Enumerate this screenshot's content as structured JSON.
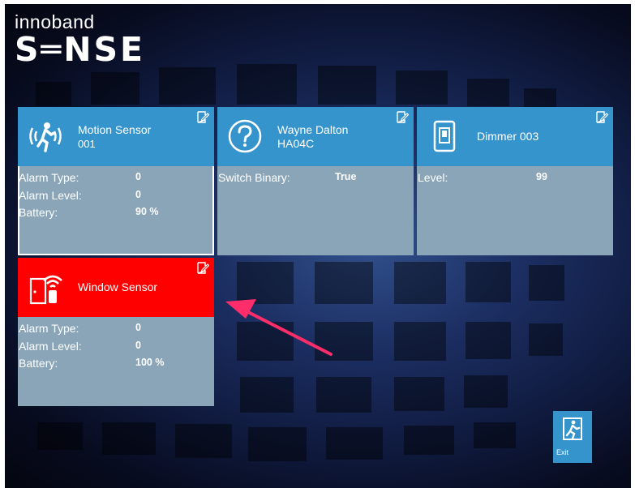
{
  "brand": {
    "line1": "innoband",
    "line2": "S═NSE"
  },
  "tiles": [
    {
      "title": "Motion Sensor",
      "subtitle": "001",
      "icon": "motion-sensor-icon",
      "state": "selected",
      "rows": [
        {
          "label": "Alarm Type:",
          "value": "0"
        },
        {
          "label": "Alarm Level:",
          "value": "0"
        },
        {
          "label": "Battery:",
          "value": "90 %"
        }
      ]
    },
    {
      "title": "Wayne Dalton",
      "subtitle": "HA04C",
      "icon": "question-icon",
      "state": "normal",
      "rows": [
        {
          "label": "Switch Binary:",
          "value": "True"
        }
      ]
    },
    {
      "title": "Dimmer 003",
      "subtitle": "",
      "icon": "dimmer-switch-icon",
      "state": "normal",
      "rows": [
        {
          "label": "Level:",
          "value": "99"
        }
      ]
    },
    {
      "title": "Window Sensor",
      "subtitle": "",
      "icon": "window-sensor-icon",
      "state": "alert",
      "rows": [
        {
          "label": "Alarm Type:",
          "value": "0"
        },
        {
          "label": "Alarm Level:",
          "value": "0"
        },
        {
          "label": "Battery:",
          "value": "100 %"
        }
      ]
    }
  ],
  "exit_button": {
    "label": "Exit"
  },
  "colors": {
    "tile_header": "#3694cc",
    "tile_body": "#8aa5b7",
    "alert_header": "#ff0000",
    "annotation_arrow": "#ff2d6a"
  }
}
